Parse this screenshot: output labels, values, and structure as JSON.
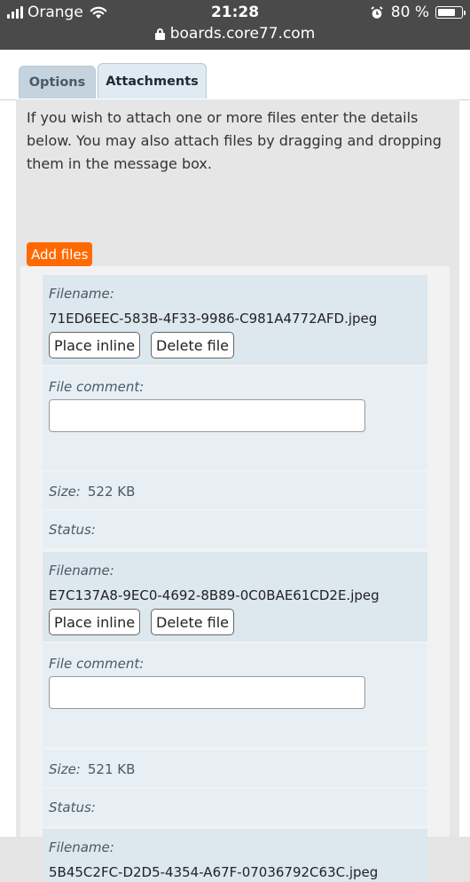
{
  "status_bar": {
    "carrier": "Orange",
    "time": "21:28",
    "battery": "80 %",
    "battery_level": 0.8,
    "url": "boards.core77.com"
  },
  "tabs": [
    {
      "label": "Options",
      "active": false
    },
    {
      "label": "Attachments",
      "active": true
    }
  ],
  "intro_text": "If you wish to attach one or more files enter the details below. You may also attach files by dragging and dropping them in the message box.",
  "add_files_label": "Add files",
  "labels": {
    "filename": "Filename:",
    "file_comment": "File comment:",
    "size": "Size:",
    "status": "Status:",
    "place_inline": "Place inline",
    "delete_file": "Delete file"
  },
  "files": [
    {
      "filename": "71ED6EEC-583B-4F33-9986-C981A4772AFD.jpeg",
      "comment": "",
      "size": "522 KB",
      "status": ""
    },
    {
      "filename": "E7C137A8-9EC0-4692-8B89-0C0BAE61CD2E.jpeg",
      "comment": "",
      "size": "521 KB",
      "status": ""
    },
    {
      "filename": "5B45C2FC-D2D5-4354-A67F-07036792C63C.jpeg"
    }
  ],
  "colors": {
    "status_bar": "#4a4a4a",
    "accent_button": "#ff6a00",
    "row_dark": "#dce7ee",
    "row_light": "#e7eff4"
  }
}
